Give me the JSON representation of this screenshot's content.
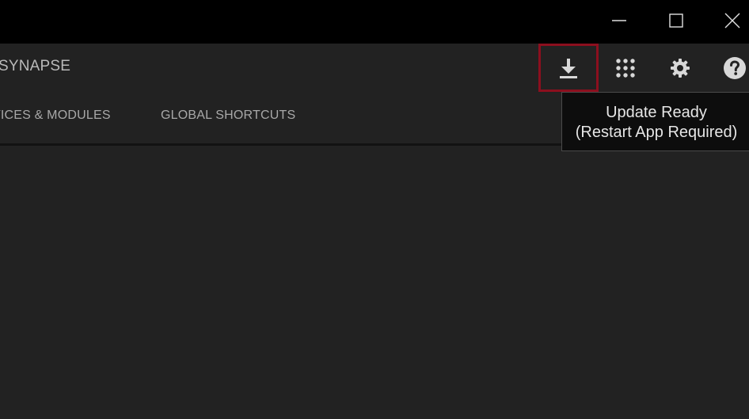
{
  "window": {
    "controls": {
      "minimize_icon": "minimize-icon",
      "maximize_icon": "maximize-icon",
      "close_icon": "close-icon"
    }
  },
  "header": {
    "brand": "SYNAPSE",
    "tabs": [
      {
        "label": "VICES & MODULES"
      },
      {
        "label": "GLOBAL SHORTCUTS"
      }
    ],
    "actions": {
      "download_icon": "download-icon",
      "apps_icon": "apps-grid-icon",
      "settings_icon": "gear-icon",
      "help_icon": "help-icon"
    }
  },
  "tooltip": {
    "line1": "Update Ready",
    "line2": "(Restart App Required)"
  },
  "colors": {
    "background": "#222222",
    "titlebar": "#000000",
    "highlight_border": "#8c0f1e",
    "text": "#b9b9b9"
  }
}
